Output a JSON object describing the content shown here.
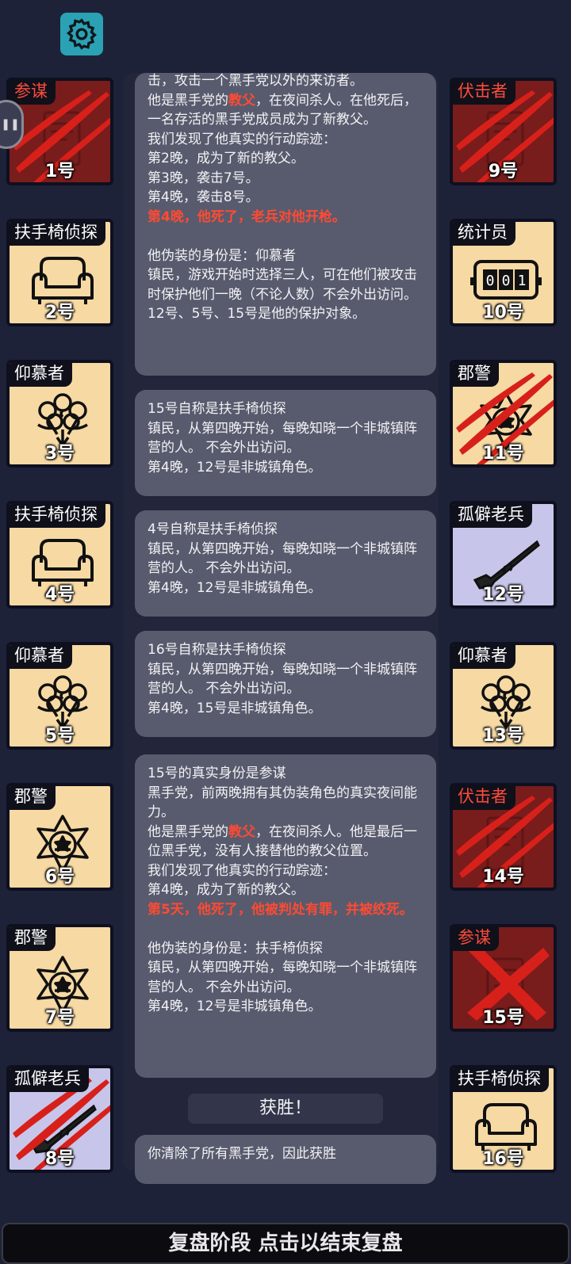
{
  "settings_icon": "gear-icon",
  "side_handle": "❚❚",
  "players_left": [
    {
      "num": "1号",
      "role": "参谋",
      "enemy": true,
      "style": "red",
      "icon": "scroll-icon",
      "mark": "claw"
    },
    {
      "num": "2号",
      "role": "扶手椅侦探",
      "enemy": false,
      "style": "tan",
      "icon": "armchair-icon",
      "mark": ""
    },
    {
      "num": "3号",
      "role": "仰慕者",
      "enemy": false,
      "style": "tan",
      "icon": "bouquet-icon",
      "mark": ""
    },
    {
      "num": "4号",
      "role": "扶手椅侦探",
      "enemy": false,
      "style": "tan",
      "icon": "armchair-icon",
      "mark": ""
    },
    {
      "num": "5号",
      "role": "仰慕者",
      "enemy": false,
      "style": "tan",
      "icon": "bouquet-icon",
      "mark": ""
    },
    {
      "num": "6号",
      "role": "郡警",
      "enemy": false,
      "style": "tan",
      "icon": "sheriff-badge-icon",
      "mark": ""
    },
    {
      "num": "7号",
      "role": "郡警",
      "enemy": false,
      "style": "tan",
      "icon": "sheriff-badge-icon",
      "mark": ""
    },
    {
      "num": "8号",
      "role": "孤僻老兵",
      "enemy": false,
      "style": "blue",
      "icon": "rifle-icon",
      "mark": "claw"
    }
  ],
  "players_right": [
    {
      "num": "9号",
      "role": "伏击者",
      "enemy": true,
      "style": "red",
      "icon": "scroll-icon",
      "mark": "claw"
    },
    {
      "num": "10号",
      "role": "统计员",
      "enemy": false,
      "style": "tan",
      "icon": "counter-icon",
      "mark": ""
    },
    {
      "num": "11号",
      "role": "郡警",
      "enemy": false,
      "style": "tan",
      "icon": "sheriff-badge-icon",
      "mark": "claw"
    },
    {
      "num": "12号",
      "role": "孤僻老兵",
      "enemy": false,
      "style": "blue",
      "icon": "rifle-icon",
      "mark": ""
    },
    {
      "num": "13号",
      "role": "仰慕者",
      "enemy": false,
      "style": "tan",
      "icon": "bouquet-icon",
      "mark": ""
    },
    {
      "num": "14号",
      "role": "伏击者",
      "enemy": true,
      "style": "red",
      "icon": "scroll-icon",
      "mark": "claw"
    },
    {
      "num": "15号",
      "role": "参谋",
      "enemy": true,
      "style": "red",
      "icon": "scroll-icon",
      "mark": "x"
    },
    {
      "num": "16号",
      "role": "扶手椅侦探",
      "enemy": false,
      "style": "tan",
      "icon": "armchair-icon",
      "mark": ""
    }
  ],
  "messages": [
    {
      "parts": [
        {
          "t": "击，攻击一个黑手党以外的来访者。\n他是黑手党的",
          "h": false
        },
        {
          "t": "教父",
          "h": true
        },
        {
          "t": "，在夜间杀人。在他死后，一名存活的黑手党成员成为了新教父。\n我们发现了他真实的行动踪迹：\n第2晚，成为了新的教父。\n第3晚，袭击7号。\n第4晚，袭击8号。\n",
          "h": false
        },
        {
          "t": "第4晚，他死了，老兵对他开枪。",
          "h": true
        },
        {
          "t": "\n\n他伪装的身份是：仰慕者\n镇民，游戏开始时选择三人，可在他们被攻击时保护他们一晚（不论人数）不会外出访问。\n12号、5号、15号是他的保护对象。",
          "h": false
        }
      ]
    },
    {
      "parts": [
        {
          "t": "15号自称是扶手椅侦探\n镇民，从第四晚开始，每晚知晓一个非城镇阵营的人。 不会外出访问。\n第4晚，12号是非城镇角色。",
          "h": false
        }
      ]
    },
    {
      "parts": [
        {
          "t": "4号自称是扶手椅侦探\n镇民，从第四晚开始，每晚知晓一个非城镇阵营的人。 不会外出访问。\n第4晚，12号是非城镇角色。",
          "h": false
        }
      ]
    },
    {
      "parts": [
        {
          "t": "16号自称是扶手椅侦探\n镇民，从第四晚开始，每晚知晓一个非城镇阵营的人。 不会外出访问。\n第4晚，15号是非城镇角色。",
          "h": false
        }
      ]
    },
    {
      "parts": [
        {
          "t": "15号的真实身份是参谋\n黑手党，前两晚拥有其伪装角色的真实夜间能力。\n他是黑手党的",
          "h": false
        },
        {
          "t": "教父",
          "h": true
        },
        {
          "t": "，在夜间杀人。他是最后一位黑手党，没有人接替他的教父位置。\n我们发现了他真实的行动踪迹：\n第4晚，成为了新的教父。\n",
          "h": false
        },
        {
          "t": "第5天，他死了，他被判处有罪，并被绞死。",
          "h": true
        },
        {
          "t": "\n\n他伪装的身份是：扶手椅侦探\n镇民，从第四晚开始，每晚知晓一个非城镇阵营的人。 不会外出访问。\n第4晚，12号是非城镇角色。",
          "h": false
        }
      ]
    }
  ],
  "victory_label": "获胜！",
  "victory_text": "你清除了所有黑手党，因此获胜",
  "bottom_bar": "复盘阶段 点击以结束复盘",
  "colors": {
    "background": "#1e2238",
    "enemy_role": "#ff4b3a",
    "card_tan": "#f7d9a3",
    "card_red": "#791c1c",
    "card_blue": "#c7c6ea",
    "accent": "#2aa2b4"
  }
}
